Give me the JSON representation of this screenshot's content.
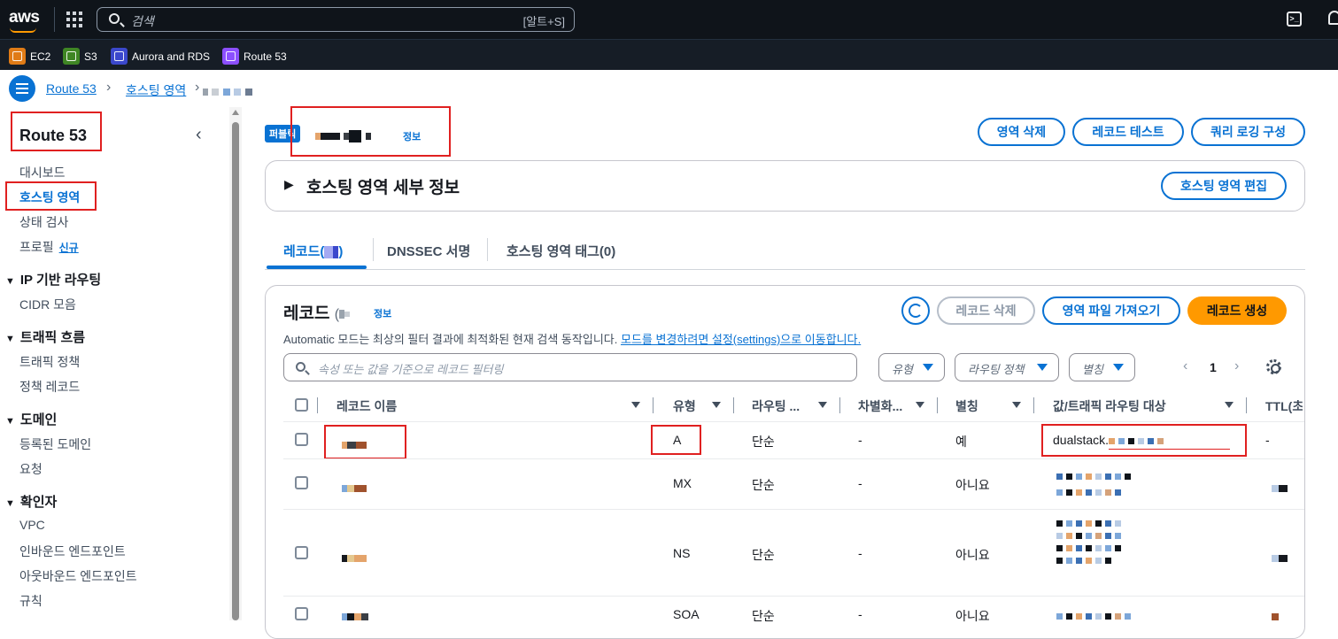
{
  "topnav": {
    "logo": "aws",
    "search_placeholder": "검색",
    "search_shortcut": "[알트+S]"
  },
  "favorites": [
    {
      "label": "EC2",
      "color": "#e07b16"
    },
    {
      "label": "S3",
      "color": "#3f8624"
    },
    {
      "label": "Aurora and RDS",
      "color": "#3b48cc"
    },
    {
      "label": "Route 53",
      "color": "#8c4fff"
    }
  ],
  "breadcrumb": {
    "items": [
      "Route 53",
      "호스팅 영역"
    ]
  },
  "sidebar": {
    "title": "Route 53",
    "items": {
      "dashboard": "대시보드",
      "hosted_zones": "호스팅 영역",
      "health_checks": "상태 검사",
      "profiles": "프로필",
      "profiles_badge": "신규",
      "cidr": "CIDR 모음",
      "traffic_policy": "트래픽 정책",
      "policy_records": "정책 레코드",
      "registered_domains": "등록된 도메인",
      "requests": "요청",
      "vpc": "VPC",
      "inbound": "인바운드 엔드포인트",
      "outbound": "아웃바운드 엔드포인트",
      "rules": "규칙"
    },
    "sections": {
      "ip_routing": "IP 기반 라우팅",
      "traffic_flow": "트래픽 흐름",
      "domains": "도메인",
      "resolver": "확인자"
    }
  },
  "header": {
    "badge": "퍼블릭",
    "info": "정보",
    "buttons": {
      "delete_zone": "영역 삭제",
      "test_record": "레코드 테스트",
      "query_logging": "쿼리 로깅 구성"
    }
  },
  "details_panel": {
    "title": "호스팅 영역 세부 정보",
    "edit_button": "호스팅 영역 편집"
  },
  "tabs": {
    "records": "레코드(",
    "records_suffix": ")",
    "dnssec": "DNSSEC 서명",
    "tags": "호스팅 영역 태그(0)"
  },
  "records_panel": {
    "title": "레코드",
    "title_paren": "(",
    "info": "정보",
    "delete_button": "레코드 삭제",
    "import_button": "영역 파일 가져오기",
    "create_button": "레코드 생성",
    "description": "Automatic 모드는 최상의 필터 결과에 최적화된 현재 검색 동작입니다.",
    "description_link": "모드를 변경하려면 설정(settings)으로 이동합니다.",
    "filter_placeholder": "속성 또는 값을 기준으로 레코드 필터링",
    "select_type": "유형",
    "select_routing": "라우팅 정책",
    "select_alias": "별칭",
    "page": "1"
  },
  "table": {
    "headers": {
      "name": "레코드 이름",
      "type": "유형",
      "routing": "라우팅 ...",
      "diff": "차별화...",
      "alias": "별칭",
      "value": "값/트래픽 라우팅 대상",
      "ttl": "TTL(초)"
    },
    "rows": [
      {
        "type": "A",
        "routing": "단순",
        "diff": "-",
        "alias": "예",
        "value": "dualstack.",
        "ttl": "-"
      },
      {
        "type": "MX",
        "routing": "단순",
        "diff": "-",
        "alias": "아니요",
        "value": "",
        "ttl": ""
      },
      {
        "type": "NS",
        "routing": "단순",
        "diff": "-",
        "alias": "아니요",
        "value": "",
        "ttl": ""
      },
      {
        "type": "SOA",
        "routing": "단순",
        "diff": "-",
        "alias": "아니요",
        "value": "",
        "ttl": ""
      }
    ]
  },
  "colors": {
    "accent": "#0972d3",
    "primary_button": "#ff9900",
    "annotation_red": "#e02020",
    "topbar": "#0f141a"
  }
}
